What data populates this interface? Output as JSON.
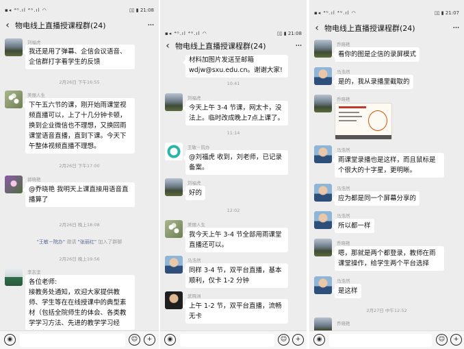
{
  "chat_title": "物电线上直播授课程群(24)",
  "more_label": "···",
  "back_label": "‹",
  "panels": [
    {
      "status_left": "▪◂ ⁴ᴳ.ıl ⁴ᴳ.ıl ◠",
      "status_right": "▯▯ ▮ 21:08",
      "messages": [
        {
          "sender": "刘福虎",
          "text": "我还是用了弹幕、企信会议语音、企信群打字看学生的反馈"
        },
        {
          "time": "2月26日 下午16:55"
        },
        {
          "sender": "美丽人生",
          "text": "下午五六节的课，刚开始雨课堂视频直播可以，上了十几分钟卡顿，换到企业微信也不理想，又换回雨课堂语音直播，直到下课。今天下午整体视频直播不理想。"
        },
        {
          "time": "2月26日 下午17:00"
        },
        {
          "sender": "郭晓艳",
          "text": "@乔晓艳  我明天上课直接用语音直播算了"
        },
        {
          "time": "2月26日 晚上18:08"
        },
        {
          "sys_name1": "\"王敏－院办\"",
          "sys_mid": "邀请",
          "sys_name2": "\"张丽红\"",
          "sys_tail": "加入了群聊"
        },
        {
          "time": "2月26日 晚上19:56"
        },
        {
          "sender": "李志坚",
          "text": "各位老师:\n接教务处通知，欢迎大家提供教师、学生等在在线授课中的典型素材（包括全院师生的体会、各类教学学习方法、先进的教学学习经验、相"
        }
      ]
    },
    {
      "status_left": "▪◂ ⁴ᴳ.ıl ⁴ᴳ.ıl ◠",
      "status_right": "▯▯ ▮ 21:08",
      "messages": [
        {
          "text": "材料加图片发送至邮箱 wdjw@sxu.edu.cn。谢谢大家!"
        },
        {
          "time": "10:41"
        },
        {
          "sender": "刘福虎",
          "text": "今天上午 3-4 节课，网太卡，没法上。临时改成晚上7点上课了。"
        },
        {
          "time": "11:14"
        },
        {
          "sender": "王敏－院办",
          "text": "@刘福虎 收到，刘老师，已记录备案。"
        },
        {
          "sender": "刘福虎",
          "text": "好的"
        },
        {
          "time": "12:02"
        },
        {
          "sender": "美丽人生",
          "text": "我今天上午 3-4 节全部用雨课堂直播还可以。"
        },
        {
          "sender": "马浩然",
          "text": "同样 3-4 节，双平台直播，基本顺利，仅卡 1-2 分钟"
        },
        {
          "sender": "武晓洲",
          "text": "上午 1-2 节，双平台直播，流畅无卡"
        }
      ]
    },
    {
      "status_left": "▪◂ ⁴ᴳ.ıl ⁴ᴳ.ıl ◠",
      "status_right": "▯▯ ▮ 21:07",
      "messages": [
        {
          "sender": "乔晓艳",
          "text": "看你的图是企信的录屏模式"
        },
        {
          "sender": "马浩然",
          "text": "是的，我从录播里截取的"
        },
        {
          "sender": "乔晓艳",
          "image": true
        },
        {
          "sender": "马浩然",
          "text": "雨课堂录播也是这样，而且鼠标是个很大的十字星，更明晰。"
        },
        {
          "sender": "马浩然",
          "text": "应为都是同一个屏幕分享的"
        },
        {
          "sender": "马浩然",
          "text": "所以都一样"
        },
        {
          "sender": "乔晓艳",
          "text": "嗯，那就是两个都登录，教师在雨课堂操作，给学生两个平台选择"
        },
        {
          "sender": "马浩然",
          "text": "是这样"
        },
        {
          "time": "2月27日 中午12:52"
        },
        {
          "sender": "乔晓艳"
        }
      ]
    }
  ],
  "input_bar": {
    "voice_icon": "◉",
    "emoji_icon": "☺",
    "plus_icon": "+"
  }
}
